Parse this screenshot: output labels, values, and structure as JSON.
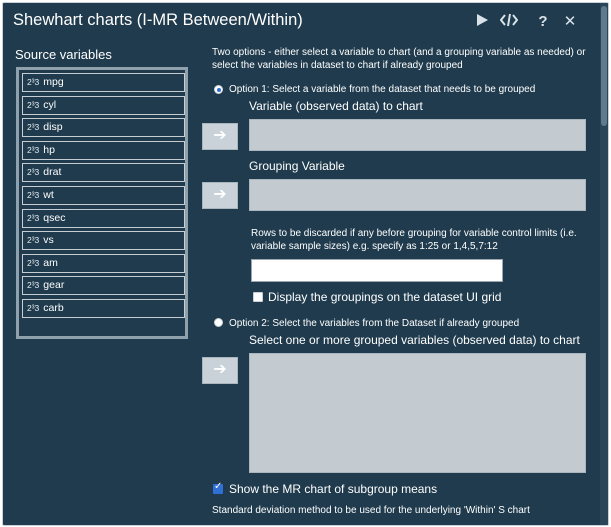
{
  "window": {
    "title": "Shewhart charts (I-MR Between/Within)",
    "icons": [
      "run-icon",
      "code-icon",
      "help-icon",
      "close-icon"
    ]
  },
  "source": {
    "heading": "Source variables",
    "type_glyph": "2³3",
    "items": [
      "mpg",
      "cyl",
      "disp",
      "hp",
      "drat",
      "wt",
      "qsec",
      "vs",
      "am",
      "gear",
      "carb"
    ]
  },
  "instructions": {
    "line1": "Two options - either select a variable to chart (and a grouping variable as needed) or",
    "line2": "select the variables in dataset to chart if already grouped"
  },
  "option1": {
    "label": "Option 1: Select a variable from the dataset that needs to be grouped",
    "variable_label": "Variable (observed data) to chart",
    "grouping_label": "Grouping Variable",
    "rows_label_line1": "Rows to be discarded if any before grouping for variable control limits (i.e.",
    "rows_label_line2": "variable sample sizes) e.g. specify as 1:25 or 1,4,5,7:12",
    "rows_value": "",
    "display_groupings_label": "Display the groupings on the dataset UI grid"
  },
  "option2": {
    "label": "Option 2: Select the variables from the Dataset if already grouped",
    "grouped_label": "Select one or more grouped variables (observed data) to chart"
  },
  "footer": {
    "mr_chart_label": "Show the MR chart of subgroup means",
    "sd_method_label": "Standard deviation method to be used for the underlying 'Within' S chart"
  },
  "state": {
    "option1_selected": true,
    "option2_selected": false,
    "display_groupings_checked": false,
    "mr_chart_checked": true
  },
  "colors": {
    "background": "#1f3b4d",
    "drop_zone": "#c3cbd1",
    "accent": "#2f6fd6"
  }
}
